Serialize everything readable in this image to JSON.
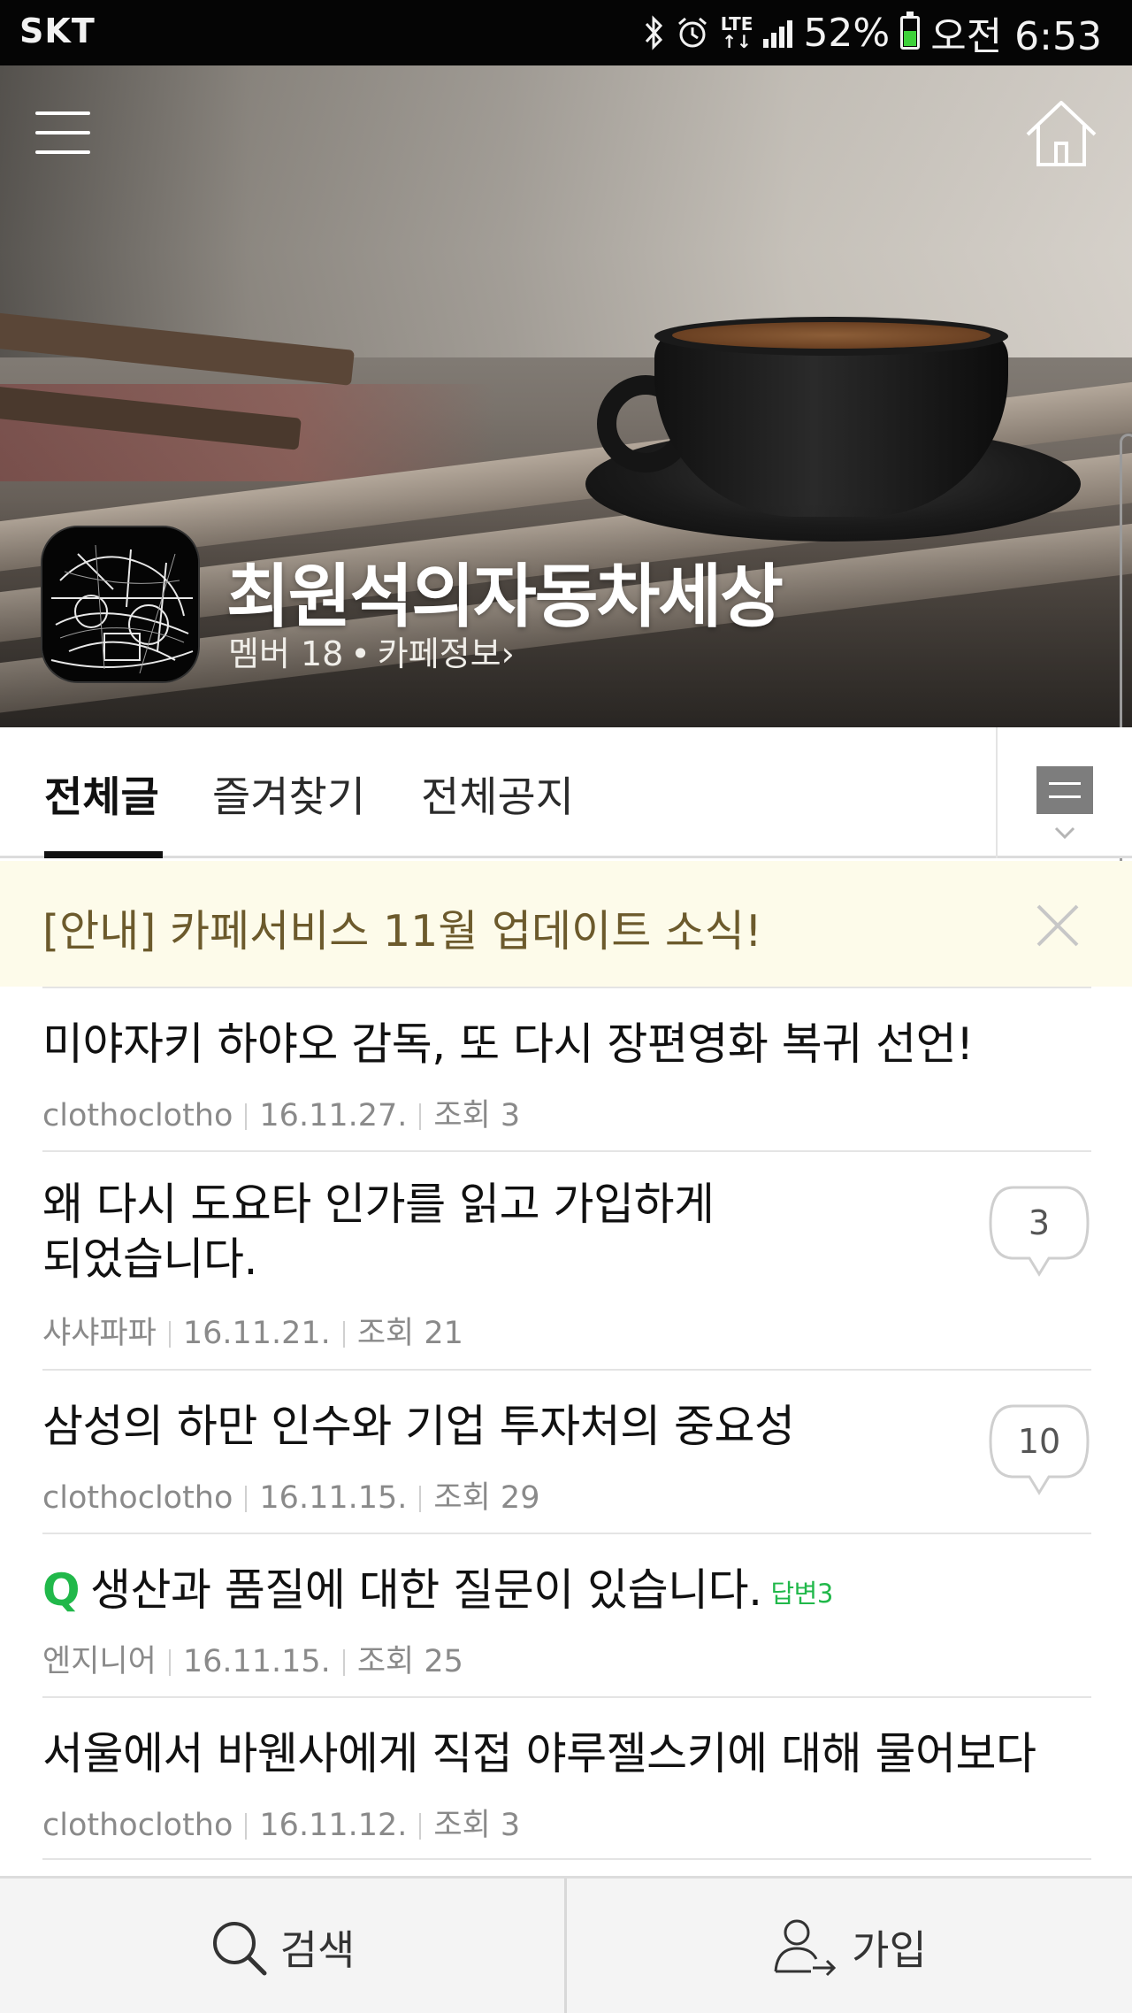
{
  "status_bar": {
    "carrier": "SKT",
    "lte": "LTE",
    "battery_percent": "52%",
    "battery_level": 0.52,
    "time": "오전 6:53",
    "icons": [
      "bluetooth-icon",
      "alarm-icon",
      "lte-icon",
      "signal-icon",
      "battery-icon"
    ]
  },
  "hero": {
    "cafe_name": "최원석의자동차세상",
    "member_label": "멤버 18",
    "dot": "•",
    "cafe_info_label": "카페정보›",
    "menu_icon": "hamburger-menu-icon",
    "home_icon": "home-icon"
  },
  "tabs": [
    {
      "label": "전체글",
      "active": true
    },
    {
      "label": "즐겨찾기",
      "active": false
    },
    {
      "label": "전체공지",
      "active": false
    }
  ],
  "board_menu_icon": "board-list-icon",
  "notice": {
    "text": "[안내] 카페서비스 11월 업데이트 소식!",
    "close_icon": "close-icon"
  },
  "posts": [
    {
      "title": "미야자키 하야오 감독, 또 다시 장편영화 복귀 선언!",
      "author": "clothoclotho",
      "date": "16.11.27.",
      "views": "조회 3",
      "comments": ""
    },
    {
      "title_line1": "왜 다시 도요타 인가를 읽고 가입하게",
      "title_line2": "되었습니다.",
      "author": "샤샤파파",
      "date": "16.11.21.",
      "views": "조회 21",
      "comments": "3"
    },
    {
      "title": "삼성의 하만 인수와 기업 투자처의 중요성",
      "author": "clothoclotho",
      "date": "16.11.15.",
      "views": "조회 29",
      "comments": "10"
    },
    {
      "q_mark": "Q",
      "title": "생산과 품질에 대한 질문이 있습니다.",
      "answer": "답변3",
      "author": "엔지니어",
      "date": "16.11.15.",
      "views": "조회 25"
    },
    {
      "title": "서울에서 바웬사에게 직접 야루젤스키에 대해 물어보다",
      "author": "clothoclotho",
      "date": "16.11.12.",
      "views": "조회 3"
    }
  ],
  "bottom_bar": {
    "search_label": "검색",
    "join_label": "가입",
    "search_icon": "search-icon",
    "join_icon": "join-user-icon"
  },
  "colors": {
    "accent_green": "#21b84a",
    "notice_bg": "#fdfbea",
    "notice_text": "#6c5a2c",
    "status_bar_bg": "#050505"
  }
}
